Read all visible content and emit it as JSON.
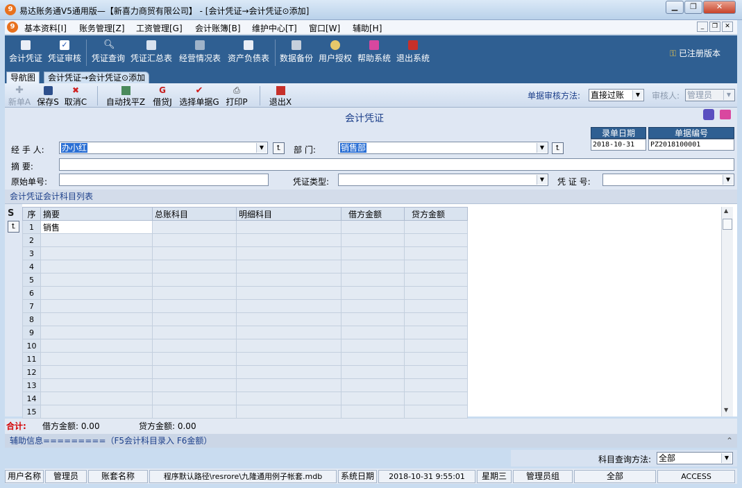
{
  "window": {
    "app_icon": "app-logo-icon",
    "title": "易达账务通V5通用版—【新喜力商贸有限公司】 - [会计凭证→会计凭证⊙添加]"
  },
  "menu": {
    "items": [
      "基本资料[I]",
      "账务管理[Z]",
      "工资管理[G]",
      "会计账簿[B]",
      "维护中心[T]",
      "窗口[W]",
      "辅助[H]"
    ]
  },
  "toolbar": {
    "items": [
      "会计凭证",
      "凭证审核",
      "凭证查询",
      "凭证汇总表",
      "经营情况表",
      "资产负债表",
      "数据备份",
      "用户授权",
      "帮助系统",
      "退出系统"
    ],
    "registered": "已注册版本"
  },
  "tabs": [
    "导航图",
    "会计凭证→会计凭证⊙添加"
  ],
  "doc_toolbar": {
    "new": "新单A",
    "save": "保存S",
    "cancel": "取消C",
    "balance": "自动找平Z",
    "debit_credit": "借贷J",
    "select_doc": "选择单据G",
    "print": "打印P",
    "exit": "退出X",
    "review_method_label": "单据审核方法:",
    "review_method_value": "直接过账",
    "reviewer_label": "审核人:",
    "reviewer_value": "管理员"
  },
  "form": {
    "title": "会计凭证",
    "entry_date_label": "录单日期",
    "entry_date": "2018-10-31",
    "doc_no_label": "单据编号",
    "doc_no": "PZ2018100001",
    "handler_label": "经 手 人:",
    "handler": "办小红",
    "dept_label": "部    门:",
    "dept": "销售部",
    "summary_label": "摘    要:",
    "summary": "",
    "orig_no_label": "原始单号:",
    "orig_no": "",
    "voucher_type_label": "凭证类型:",
    "voucher_type": "",
    "voucher_no_label": "凭 证 号:",
    "voucher_no": ""
  },
  "section_title": "会计凭证会计科目列表",
  "grid": {
    "columns": [
      "序",
      "摘要",
      "总账科目",
      "明细科目",
      "借方金额",
      "贷方金额"
    ],
    "rows": [
      [
        "1",
        "销售",
        "",
        "",
        "",
        ""
      ],
      [
        "2",
        "",
        "",
        "",
        "",
        ""
      ],
      [
        "3",
        "",
        "",
        "",
        "",
        ""
      ],
      [
        "4",
        "",
        "",
        "",
        "",
        ""
      ],
      [
        "5",
        "",
        "",
        "",
        "",
        ""
      ],
      [
        "6",
        "",
        "",
        "",
        "",
        ""
      ],
      [
        "7",
        "",
        "",
        "",
        "",
        ""
      ],
      [
        "8",
        "",
        "",
        "",
        "",
        ""
      ],
      [
        "9",
        "",
        "",
        "",
        "",
        ""
      ],
      [
        "10",
        "",
        "",
        "",
        "",
        ""
      ],
      [
        "11",
        "",
        "",
        "",
        "",
        ""
      ],
      [
        "12",
        "",
        "",
        "",
        "",
        ""
      ],
      [
        "13",
        "",
        "",
        "",
        "",
        ""
      ],
      [
        "14",
        "",
        "",
        "",
        "",
        ""
      ],
      [
        "15",
        "",
        "",
        "",
        "",
        ""
      ]
    ]
  },
  "totals": {
    "label": "合计:",
    "debit": "借方金额: 0.00",
    "credit": "贷方金额: 0.00"
  },
  "aux_info": "辅助信息=========（F5会计科目录入  F6金额）",
  "query": {
    "label": "科目查询方法:",
    "value": "全部"
  },
  "status": {
    "user_label": "用户名称",
    "user": "管理员",
    "account_label": "账套名称",
    "account_path": "程序默认路径\\resrore\\九隆通用例子帐套.mdb",
    "date_label": "系统日期",
    "datetime": "2018-10-31  9:55:01",
    "weekday": "星期三",
    "group": "管理员组",
    "scope": "全部",
    "db": "ACCESS"
  },
  "colors": {
    "toolbar_bg": "#2f5f92",
    "title_accent": "#1c3f8a",
    "total_label": "#d40000"
  }
}
